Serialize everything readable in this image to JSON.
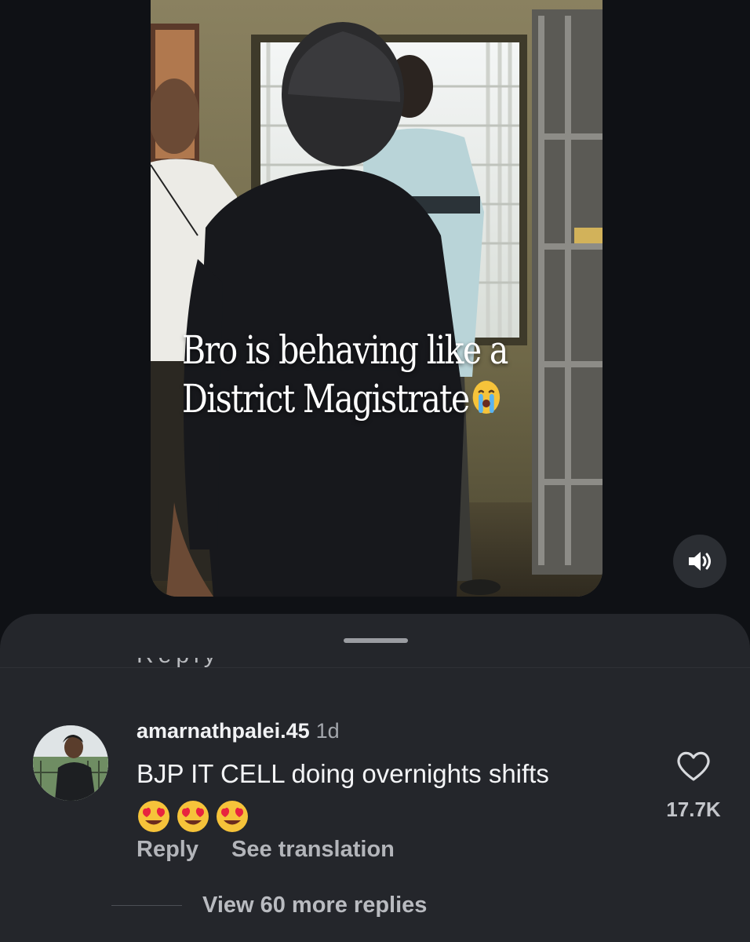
{
  "video": {
    "caption_line1": "Bro is behaving like a",
    "caption_line2": "District Magistrate",
    "caption_emoji": "loudly-crying-face",
    "sound_icon": "speaker-sound-on-icon"
  },
  "sheet": {
    "comment": {
      "username": "amarnathpalei.45",
      "timestamp": "1d",
      "text": "BJP IT CELL doing overnights shifts",
      "emojis": [
        "smiling-face-with-heart-eyes",
        "smiling-face-with-heart-eyes",
        "smiling-face-with-heart-eyes"
      ],
      "like_icon": "heart-outline-icon",
      "like_count": "17.7K",
      "reply_label": "Reply",
      "translate_label": "See translation"
    },
    "view_more_replies": "View 60 more replies"
  },
  "colors": {
    "background": "#0f1115",
    "sheet": "#24262b",
    "primary_text": "#f3f4f6",
    "secondary_text": "#b3b5ba"
  }
}
